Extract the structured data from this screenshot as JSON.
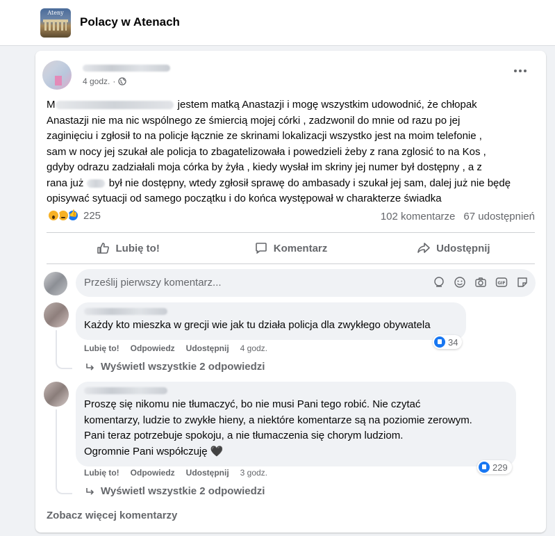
{
  "group": {
    "name": "Polacy w Atenach",
    "thumb_tag": "Ateny"
  },
  "post": {
    "time": "4 godz.",
    "text_lead": " jestem matką Anastazji i mogę wszystkim udowodnić, że chłopak\nAnastazji nie ma nic wspólnego ze śmiercią mojej córki , zadzwonil do mnie od razu po jej\nzaginięciu i zgłosił to na policje łącznie ze skrinami lokalizacji wszystko jest na moim telefonie ,\nsam w nocy jej szukał ale policja to zbagatelizowała i powedzieli żeby z rana zglosić to na Kos ,\ngdyby odrazu zadziałali moja córka by żyła , kiedy wysłał im skriny jej numer był dostępny , a z\nrana już ",
    "text_tail": " był nie dostępny, wtedy zgłosił sprawę do ambasady i szukał jej sam, dalej już nie będę\nopisywać sytuacji od samego początku i do końca występował w charakterze świadka",
    "text_start": "M",
    "reactions_count": "225",
    "comments_count": "102 komentarze",
    "shares_count": "67 udostępnień"
  },
  "actions": {
    "like": "Lubię to!",
    "comment": "Komentarz",
    "share": "Udostępnij"
  },
  "comment_box": {
    "placeholder": "Prześlij pierwszy komentarz..."
  },
  "comments": [
    {
      "text": "Każdy kto mieszka w grecji wie jak tu działa policja dla zwykłego obywatela",
      "likes": "34",
      "like_label": "Lubię to!",
      "reply_label": "Odpowiedz",
      "share_label": "Udostępnij",
      "time": "4 godz.",
      "replies_label": "Wyświetl wszystkie 2 odpowiedzi"
    },
    {
      "text": "Proszę się nikomu nie tłumaczyć, bo nie musi Pani tego robić. Nie czytać\nkomentarzy, ludzie to zwykłe hieny, a niektóre komentarze są na poziomie zerowym.\nPani teraz potrzebuje spokoju, a nie tłumaczenia się chorym ludziom.\nOgromnie Pani współczuję 🖤",
      "likes": "229",
      "like_label": "Lubię to!",
      "reply_label": "Odpowiedz",
      "share_label": "Udostępnij",
      "time": "3 godz.",
      "replies_label": "Wyświetl wszystkie 2 odpowiedzi"
    }
  ],
  "see_more": "Zobacz więcej komentarzy",
  "colors": {
    "accent": "#1877f2",
    "muted": "#65676b",
    "background": "#f0f2f5"
  }
}
